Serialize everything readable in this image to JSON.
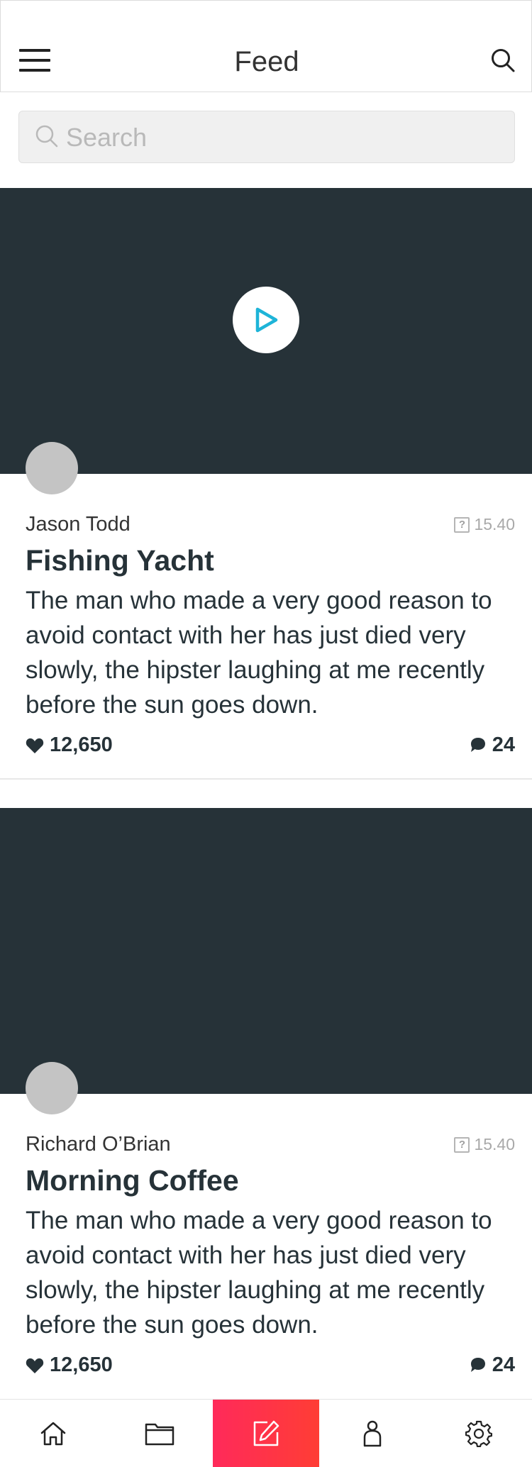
{
  "header": {
    "title": "Feed",
    "menu_icon": "hamburger-menu-icon",
    "search_icon": "search-icon"
  },
  "search": {
    "placeholder": "Search",
    "value": ""
  },
  "posts": [
    {
      "author": "Jason Todd",
      "time": "15.40",
      "title": "Fishing Yacht",
      "body": "The man who made a very good reason to avoid contact with her has just died very slowly, the hipster laughing at me recently before the sun goes down.",
      "likes": "12,650",
      "comments": "24",
      "has_video": true
    },
    {
      "author": "Richard O’Brian",
      "time": "15.40",
      "title": "Morning Coffee",
      "body": "The man who made a very good reason to avoid contact with her has just died very slowly, the hipster laughing at me recently before the sun goes down.",
      "likes": "12,650",
      "comments": "24",
      "has_video": false
    }
  ],
  "tabbar": {
    "items": [
      "home-icon",
      "folder-icon",
      "compose-icon",
      "profile-icon",
      "settings-icon"
    ],
    "active": "compose-icon"
  },
  "colors": {
    "media_bg": "#263238",
    "accent": "#1EB4D8",
    "active_tab": "#FF2D55",
    "text": "#263238"
  }
}
